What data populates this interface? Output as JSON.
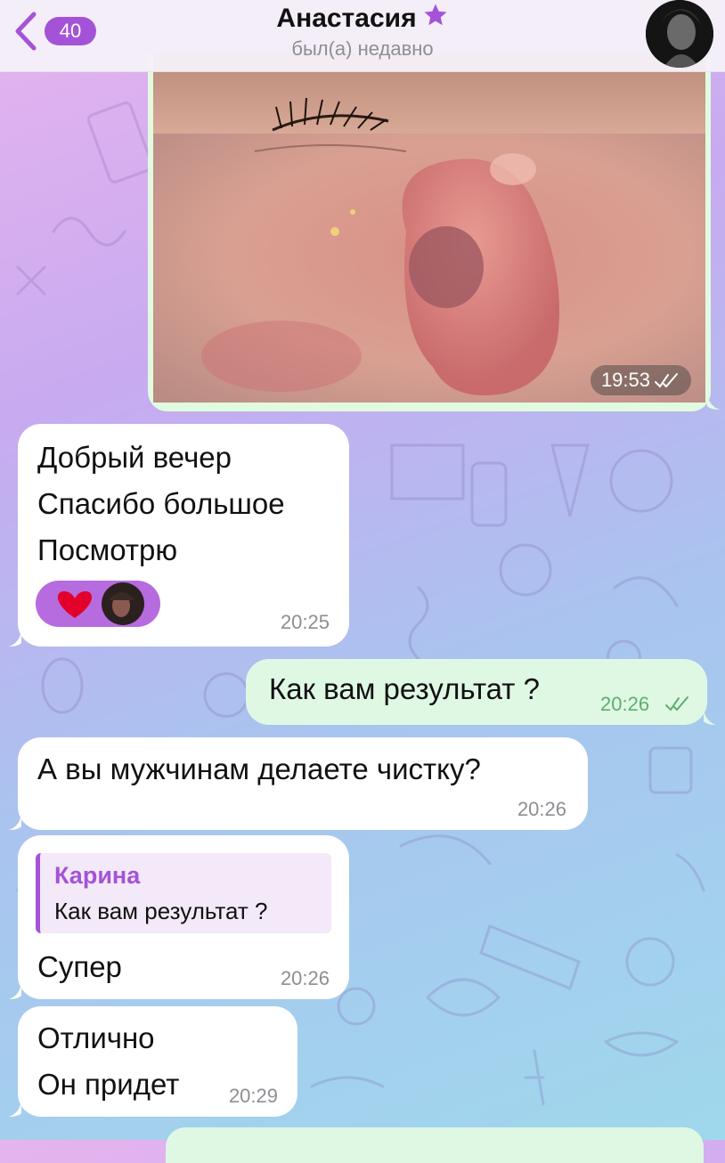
{
  "header": {
    "back_count": "40",
    "contact_name": "Анастасия",
    "status": "был(а) недавно"
  },
  "messages": {
    "photo": {
      "time": "19:53",
      "read": true
    },
    "m1": {
      "lines": [
        "Добрый вечер",
        "Спасибо большое",
        "Посмотрю"
      ],
      "time": "20:25",
      "reaction": "❤️"
    },
    "m2": {
      "text": "Как вам результат ?",
      "time": "20:26",
      "read": true
    },
    "m3": {
      "text": "А вы мужчинам делаете чистку?",
      "time": "20:26"
    },
    "m4": {
      "reply_name": "Карина",
      "reply_text": "Как вам результат ?",
      "text": "Супер",
      "time": "20:26"
    },
    "m5": {
      "lines": [
        "Отлично",
        "Он придет"
      ],
      "time": "20:29"
    }
  },
  "colors": {
    "accent": "#a453d8",
    "incoming_bubble": "#ffffff",
    "outgoing_bubble": "#dff8e4",
    "outgoing_time": "#5eae6c"
  },
  "icons": [
    "back-chevron-icon",
    "star-icon",
    "read-checkmarks-icon",
    "heart-icon"
  ]
}
